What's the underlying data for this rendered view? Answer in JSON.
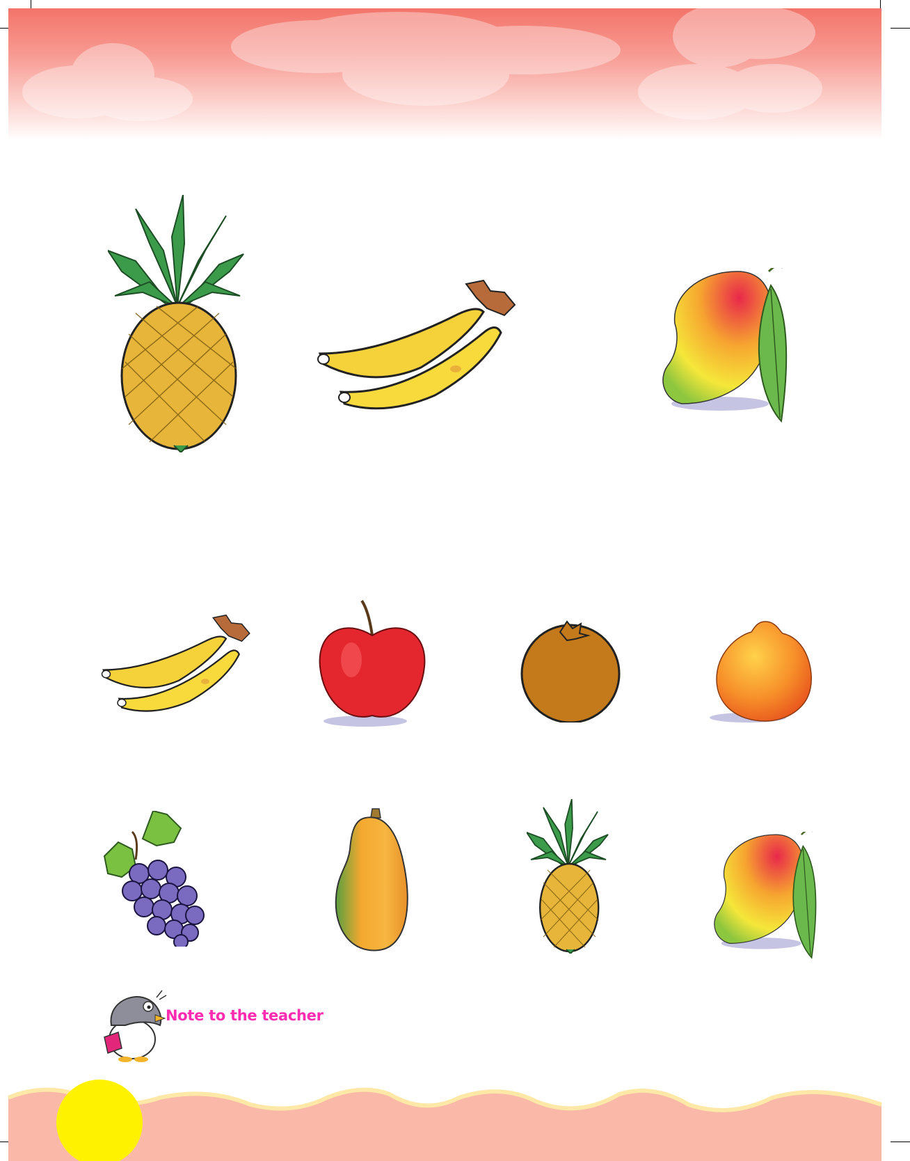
{
  "page": {
    "colors": {
      "header_top": "#f3746a",
      "footer_wave": "#f9b8a8",
      "sun": "#fff200",
      "note_text": "#ff2bb0"
    }
  },
  "top_row": [
    {
      "name": "pineapple"
    },
    {
      "name": "banana"
    },
    {
      "name": "mango"
    }
  ],
  "options_row_1": [
    {
      "name": "banana"
    },
    {
      "name": "apple"
    },
    {
      "name": "orange"
    },
    {
      "name": "sweet-lime"
    }
  ],
  "options_row_2": [
    {
      "name": "grapes"
    },
    {
      "name": "papaya"
    },
    {
      "name": "pineapple"
    },
    {
      "name": "mango"
    }
  ],
  "note": {
    "label": "Note to the teacher",
    "icon": "penguin-icon"
  }
}
